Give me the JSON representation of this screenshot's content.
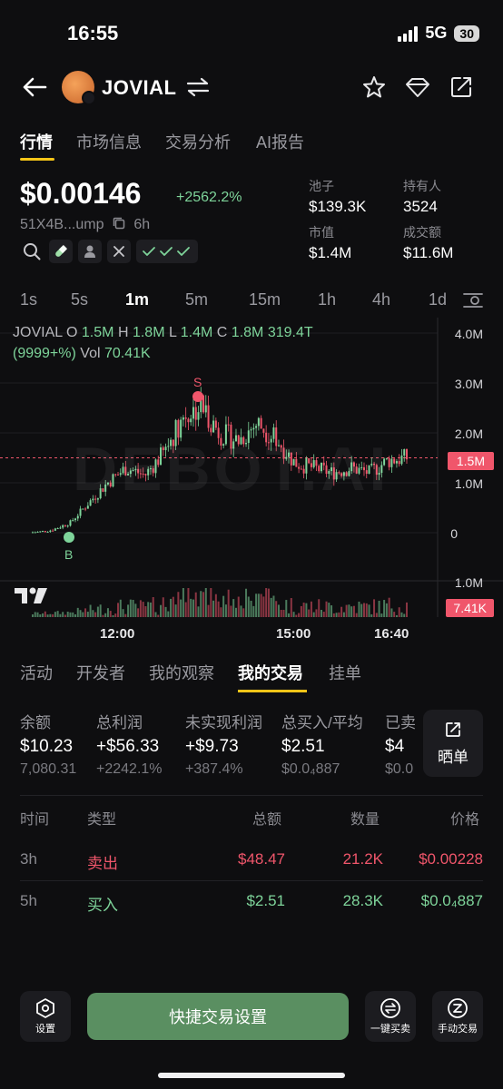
{
  "status": {
    "time": "16:55",
    "network": "5G",
    "battery": "30"
  },
  "header": {
    "token_name": "JOVIAL"
  },
  "tabs": [
    "行情",
    "市场信息",
    "交易分析",
    "AI报告"
  ],
  "price": {
    "value": "$0.00146",
    "change": "+2562.2%",
    "address": "51X4B...ump",
    "age": "6h"
  },
  "stats": {
    "pool_label": "池子",
    "pool_value": "$139.3K",
    "holders_label": "持有人",
    "holders_value": "3524",
    "mcap_label": "市值",
    "mcap_value": "$1.4M",
    "volume_label": "成交额",
    "volume_value": "$11.6M"
  },
  "intervals": [
    "1s",
    "5s",
    "1m",
    "5m",
    "15m",
    "1h",
    "4h",
    "1d"
  ],
  "chart_info": {
    "symbol": "JOVIAL",
    "o_label": "O",
    "o": "1.5M",
    "h_label": "H",
    "h": "1.8M",
    "l_label": "L",
    "l": "1.4M",
    "c_label": "C",
    "c": "1.8M",
    "extra": "319.4T",
    "pct": "(9999+%)",
    "vol_label": "Vol",
    "vol": "70.41K",
    "watermark": "DEBOT.AI",
    "buy_marker": "B",
    "sell_marker": "S",
    "current_price_tag": "1.5M",
    "volume_tag": "7.41K"
  },
  "chart_data": {
    "type": "candlestick",
    "y_ticks": [
      "4.0M",
      "3.0M",
      "2.0M",
      "1.0M",
      "0"
    ],
    "volume_axis_tick": "1.0M",
    "x_ticks": [
      "12:00",
      "15:00",
      "16:40"
    ],
    "ylim": [
      0,
      4.0
    ],
    "unit": "M",
    "series_approx": [
      0.0,
      0.05,
      0.2,
      0.6,
      1.0,
      1.3,
      1.15,
      1.6,
      2.3,
      2.55,
      2.0,
      1.85,
      2.2,
      1.9,
      1.4,
      1.3,
      1.2,
      1.3,
      1.2,
      1.45,
      1.5
    ],
    "current": 1.5,
    "markers": [
      {
        "label": "B",
        "type": "buy"
      },
      {
        "label": "S",
        "type": "sell"
      }
    ]
  },
  "bottom_tabs": [
    "活动",
    "开发者",
    "我的观察",
    "我的交易",
    "挂单"
  ],
  "summary": {
    "balance_label": "余额",
    "balance": "$10.23",
    "balance_sub": "7,080.31",
    "total_pnl_label": "总利润",
    "total_pnl": "+$56.33",
    "total_pnl_pct": "+2242.1%",
    "unrealized_label": "未实现利润",
    "unrealized": "+$9.73",
    "unrealized_pct": "+387.4%",
    "buy_avg_label": "总买入/平均",
    "buy_total": "$2.51",
    "buy_avg": "$0.0₄887",
    "sold_label": "已卖",
    "sold": "$4",
    "sold_sub": "$0.0",
    "share_label": "晒单"
  },
  "trades": {
    "headers": [
      "时间",
      "类型",
      "总额",
      "数量",
      "价格"
    ],
    "rows": [
      {
        "time": "3h",
        "type": "卖出",
        "total": "$48.47",
        "qty": "21.2K",
        "price": "$0.00228"
      },
      {
        "time": "5h",
        "type": "买入",
        "total": "$2.51",
        "qty": "28.3K",
        "price": "$0.0₄887"
      }
    ]
  },
  "actions": {
    "settings": "设置",
    "quick": "快捷交易设置",
    "one_click": "一键买卖",
    "manual": "手动交易"
  },
  "colors": {
    "green": "#7ed49a",
    "red": "#f0566b",
    "accent": "#f5c518",
    "button_green": "#5a8f61"
  }
}
